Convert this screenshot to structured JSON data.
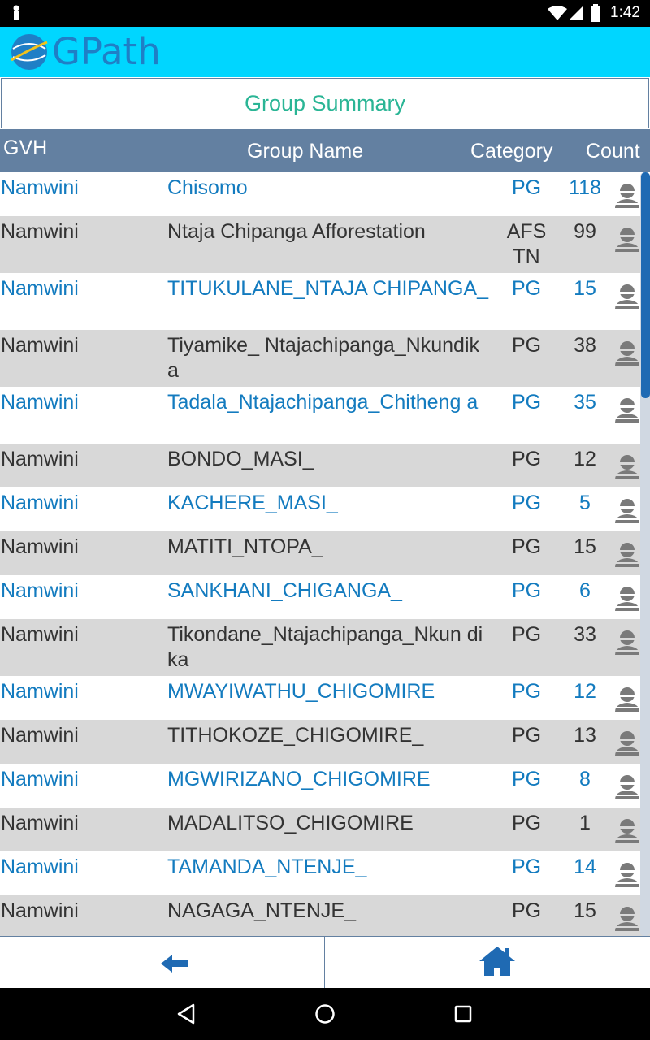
{
  "status": {
    "time": "1:42"
  },
  "app": {
    "name": "GPath"
  },
  "page": {
    "title": "Group Summary"
  },
  "table": {
    "headers": {
      "gvh": "GVH",
      "group_name": "Group Name",
      "category": "Category",
      "count": "Count"
    },
    "rows": [
      {
        "gvh": "Namwini",
        "name": "Chisomo",
        "category": "PG",
        "count": "118"
      },
      {
        "gvh": "Namwini",
        "name": "Ntaja Chipanga Afforestation",
        "category": "AFS TN",
        "count": "99"
      },
      {
        "gvh": "Namwini",
        "name": "TITUKULANE_NTAJA CHIPANGA_",
        "category": "PG",
        "count": "15"
      },
      {
        "gvh": "Namwini",
        "name": "Tiyamike_ Ntajachipanga_Nkundika",
        "category": "PG",
        "count": "38"
      },
      {
        "gvh": "Namwini",
        "name": "Tadala_Ntajachipanga_Chitheng a",
        "category": "PG",
        "count": "35"
      },
      {
        "gvh": "Namwini",
        "name": "BONDO_MASI_",
        "category": "PG",
        "count": "12"
      },
      {
        "gvh": "Namwini",
        "name": "KACHERE_MASI_",
        "category": "PG",
        "count": "5"
      },
      {
        "gvh": "Namwini",
        "name": "MATITI_NTOPA_",
        "category": "PG",
        "count": "15"
      },
      {
        "gvh": "Namwini",
        "name": "SANKHANI_CHIGANGA_",
        "category": "PG",
        "count": "6"
      },
      {
        "gvh": "Namwini",
        "name": "Tikondane_Ntajachipanga_Nkun dika",
        "category": "PG",
        "count": "33"
      },
      {
        "gvh": "Namwini",
        "name": "MWAYIWATHU_CHIGOMIRE",
        "category": "PG",
        "count": "12"
      },
      {
        "gvh": "Namwini",
        "name": "TITHOKOZE_CHIGOMIRE_",
        "category": "PG",
        "count": "13"
      },
      {
        "gvh": "Namwini",
        "name": "MGWIRIZANO_CHIGOMIRE",
        "category": "PG",
        "count": "8"
      },
      {
        "gvh": "Namwini",
        "name": "MADALITSO_CHIGOMIRE",
        "category": "PG",
        "count": "1"
      },
      {
        "gvh": "Namwini",
        "name": "TAMANDA_NTENJE_",
        "category": "PG",
        "count": "14"
      },
      {
        "gvh": "Namwini",
        "name": "NAGAGA_NTENJE_",
        "category": "PG",
        "count": "15"
      }
    ]
  },
  "icons": {
    "row_action": "person-icon",
    "back": "back-arrow-icon",
    "home": "home-icon"
  },
  "colors": {
    "app_bar": "#00d6ff",
    "header": "#6380a1",
    "title_text": "#2ab595",
    "blue_row_text": "#137bbf",
    "gray_row_bg": "#d8d8d8"
  }
}
